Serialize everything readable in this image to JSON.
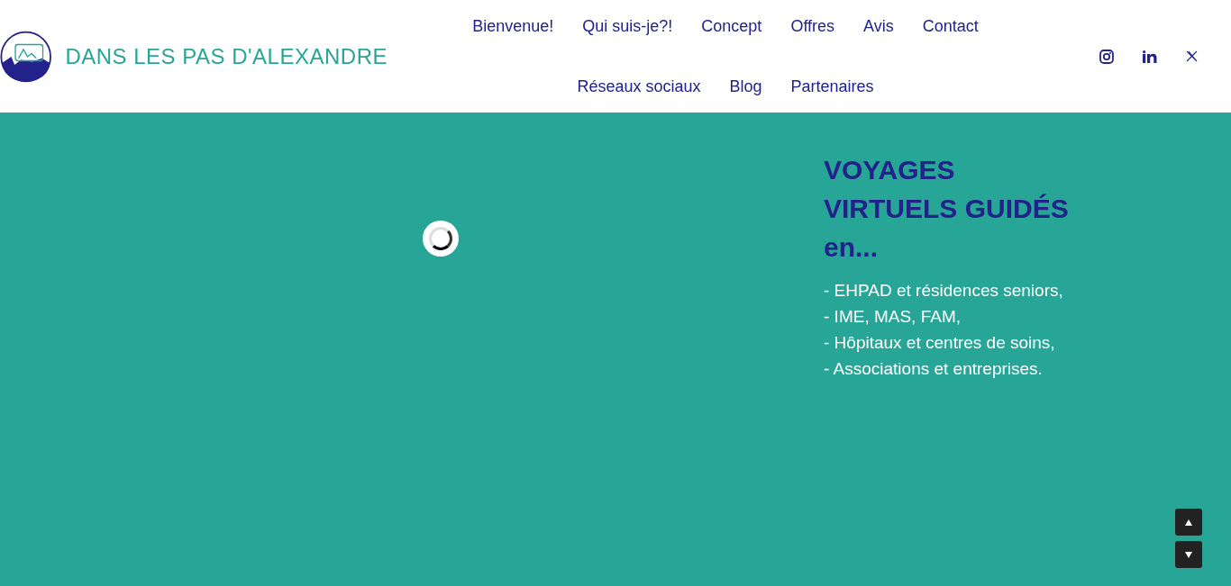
{
  "logo": {
    "text": "DANS LES PAS D'ALEXANDRE"
  },
  "nav": {
    "items": [
      {
        "label": "Bienvenue!"
      },
      {
        "label": "Qui suis-je?!"
      },
      {
        "label": "Concept"
      },
      {
        "label": "Offres"
      },
      {
        "label": "Avis"
      },
      {
        "label": "Contact"
      },
      {
        "label": "Réseaux sociaux"
      },
      {
        "label": "Blog"
      },
      {
        "label": "Partenaires"
      }
    ]
  },
  "social": [
    {
      "kind": "instagram"
    },
    {
      "kind": "linkedin"
    },
    {
      "kind": "x"
    }
  ],
  "hero": {
    "heading": "VOYAGES VIRTUELS GUIDÉS en...",
    "list": [
      "- EHPAD et résidences seniors,",
      "- IME, MAS, FAM,",
      "- Hôpitaux et centres de soins,",
      "- Associations et entreprises."
    ]
  }
}
